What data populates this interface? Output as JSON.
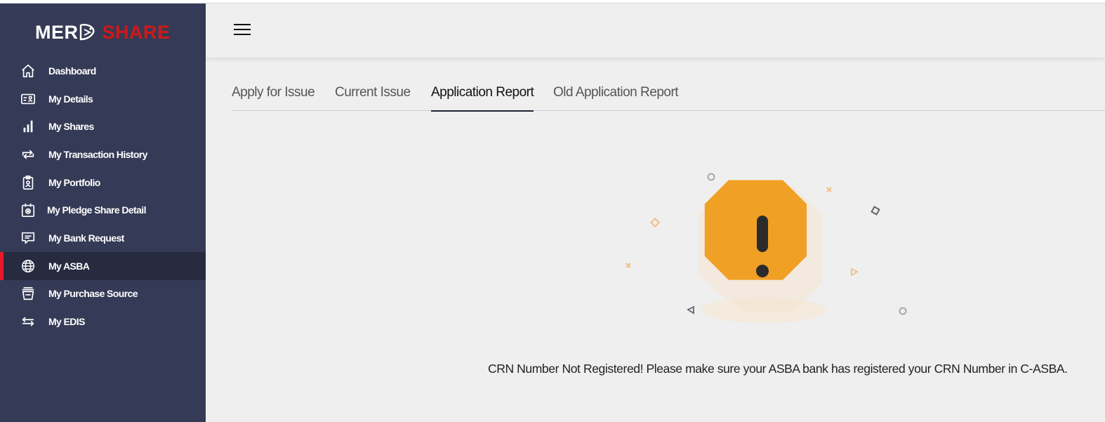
{
  "brand": {
    "part1": "MER",
    "part2": "SHARE"
  },
  "sidebar": {
    "items": [
      {
        "label": "Dashboard",
        "icon": "home-icon"
      },
      {
        "label": "My Details",
        "icon": "id-card-icon"
      },
      {
        "label": "My Shares",
        "icon": "bar-chart-icon"
      },
      {
        "label": "My Transaction History",
        "icon": "swap-icon"
      },
      {
        "label": "My Portfolio",
        "icon": "clipboard-user-icon"
      },
      {
        "label": "My Pledge Share Detail",
        "icon": "calendar-badge-icon"
      },
      {
        "label": "My Bank Request",
        "icon": "message-icon"
      },
      {
        "label": "My ASBA",
        "icon": "globe-icon",
        "active": true
      },
      {
        "label": "My Purchase Source",
        "icon": "basket-icon"
      },
      {
        "label": "My EDIS",
        "icon": "exchange-arrows-icon"
      }
    ]
  },
  "header": {
    "menu_icon": "hamburger-icon"
  },
  "tabs": [
    {
      "label": "Apply for Issue"
    },
    {
      "label": "Current Issue"
    },
    {
      "label": "Application Report",
      "active": true
    },
    {
      "label": "Old Application Report"
    }
  ],
  "main": {
    "message": "CRN Number Not Registered! Please make sure your ASBA bank has registered your CRN Number in C-ASBA.",
    "illustration_icon": "warning-octagon-icon"
  },
  "colors": {
    "sidebar_bg": "#353b56",
    "active_bg": "#262b40",
    "active_marker": "#e8192c",
    "brand_red": "#d01818",
    "warning_orange": "#f0a024",
    "content_bg": "#efefef"
  }
}
